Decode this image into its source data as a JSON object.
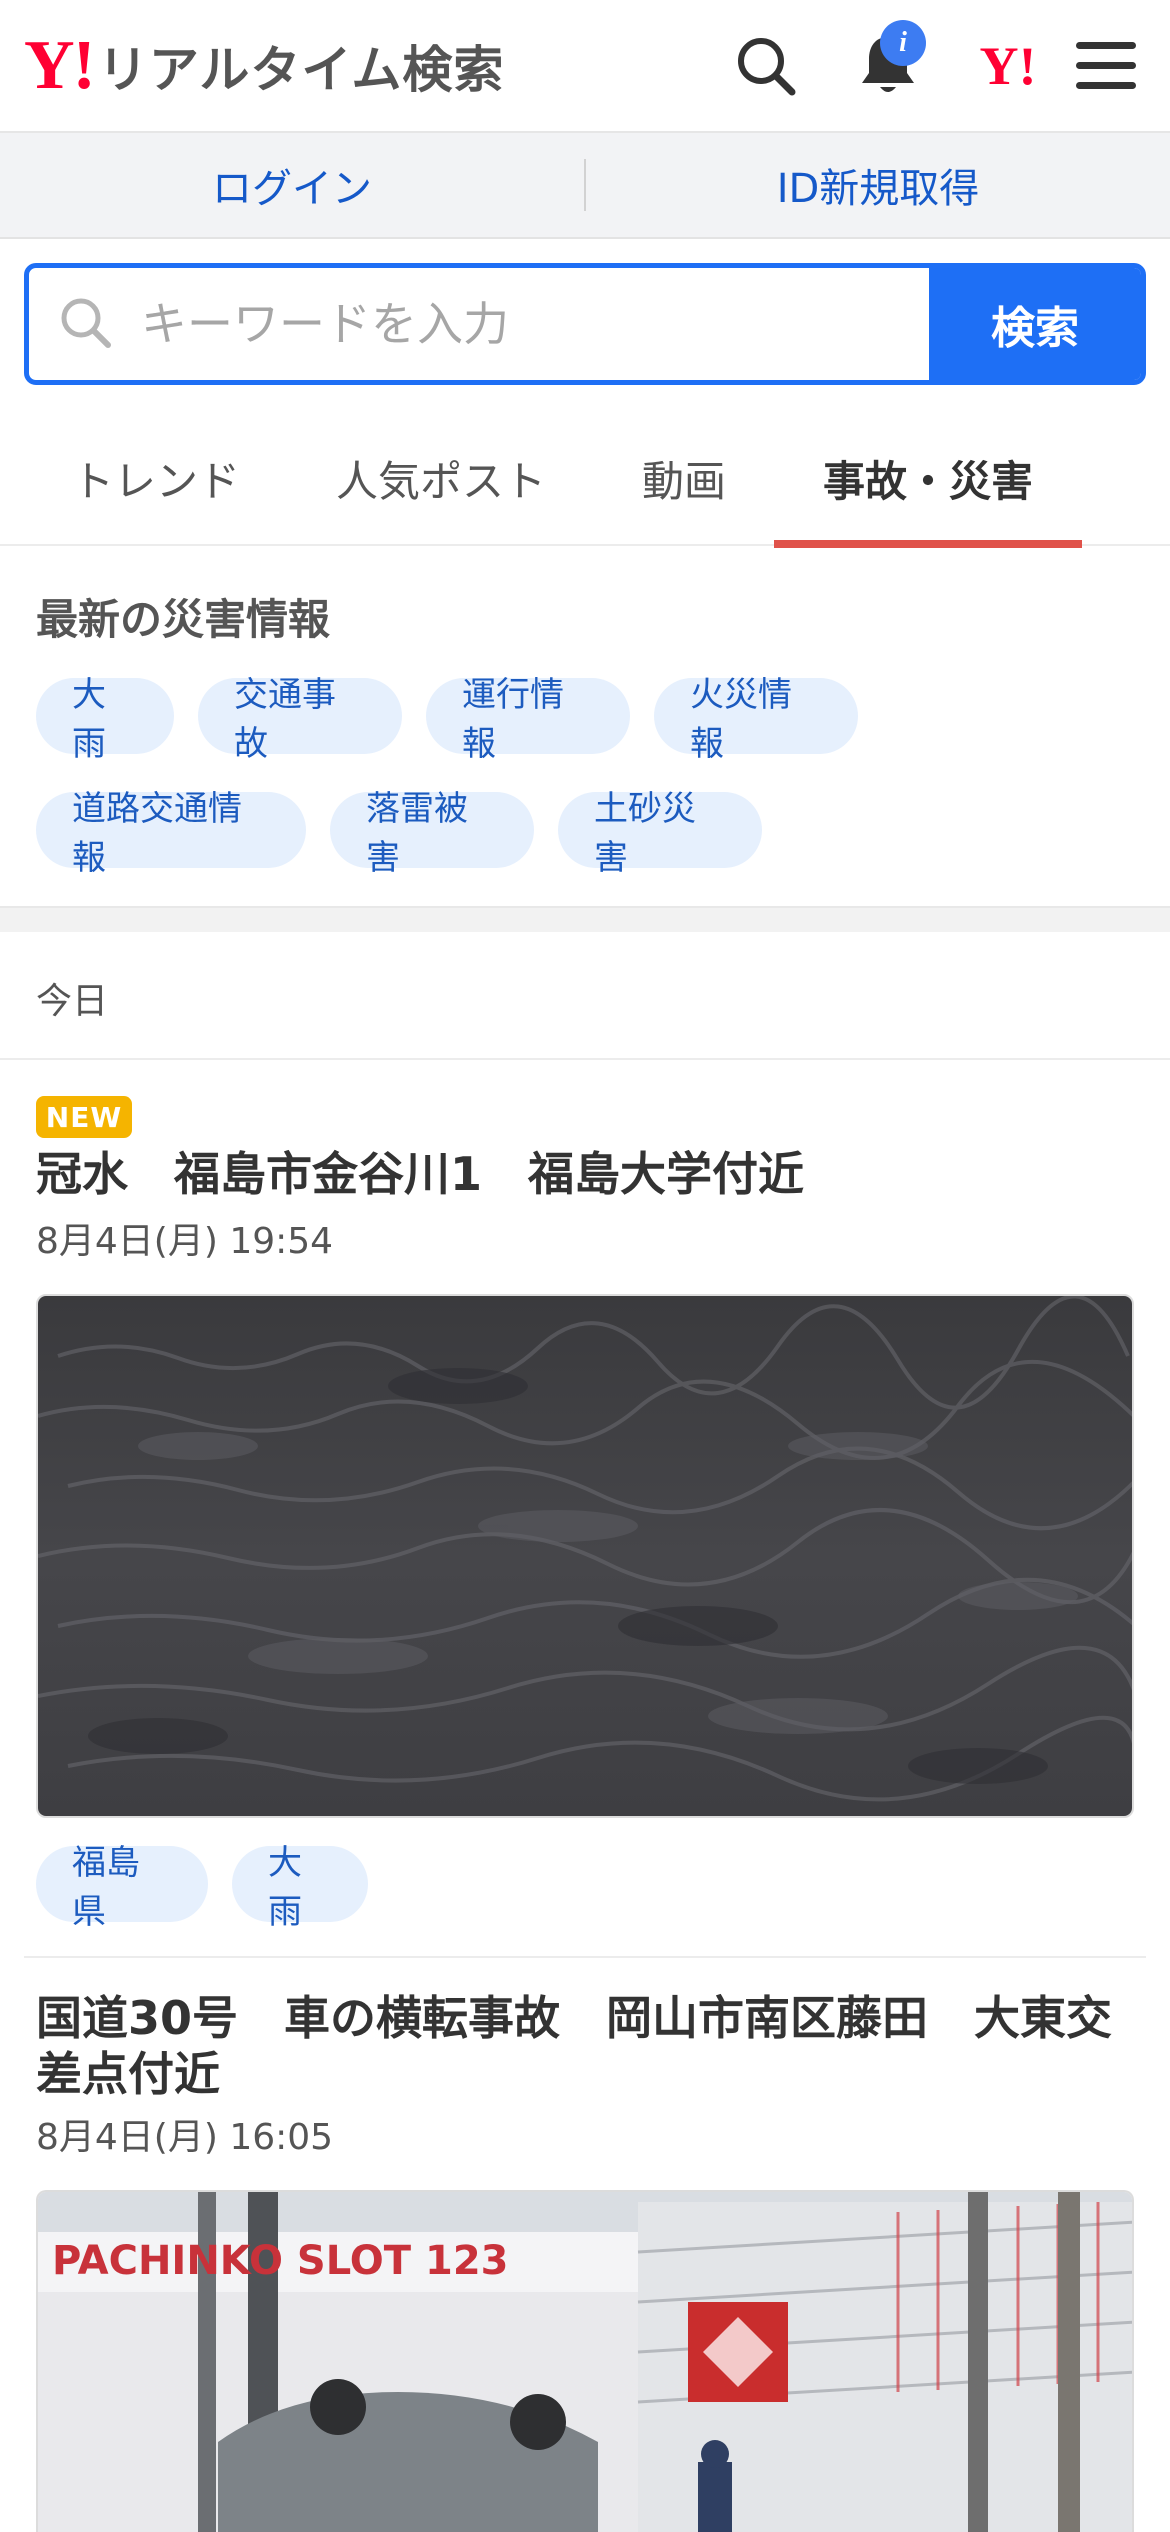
{
  "header": {
    "logo_mark": "Y!",
    "logo_text": "リアルタイム検索",
    "notification_badge": "i",
    "yahoo_icon_text": "Y!"
  },
  "account": {
    "login_label": "ログイン",
    "signup_label": "ID新規取得"
  },
  "search": {
    "placeholder": "キーワードを入力",
    "button_label": "検索"
  },
  "tabs": [
    {
      "label": "トレンド",
      "active": false
    },
    {
      "label": "人気ポスト",
      "active": false
    },
    {
      "label": "動画",
      "active": false
    },
    {
      "label": "事故・災害",
      "active": true
    }
  ],
  "disaster_info": {
    "title": "最新の災害情報",
    "chips": [
      "大雨",
      "交通事故",
      "運行情報",
      "火災情報",
      "道路交通情報",
      "落雷被害",
      "土砂災害"
    ]
  },
  "section_date": "今日",
  "posts": [
    {
      "badge": "NEW",
      "title": "冠水　福島市金谷川1　福島大学付近",
      "time": "8月4日(月) 19:54",
      "tags": [
        "福島県",
        "大雨"
      ]
    },
    {
      "title": "国道30号　車の横転事故　岡山市南区藤田　大東交差点付近",
      "time": "8月4日(月) 16:05",
      "image_sign_text": "PACHINKO SLOT 123"
    }
  ],
  "colors": {
    "brand_red": "#ff0033",
    "accent_blue": "#1e6ff5",
    "tab_underline": "#e0524a",
    "chip_bg": "#e6f0fd",
    "new_badge": "#f5b400"
  }
}
